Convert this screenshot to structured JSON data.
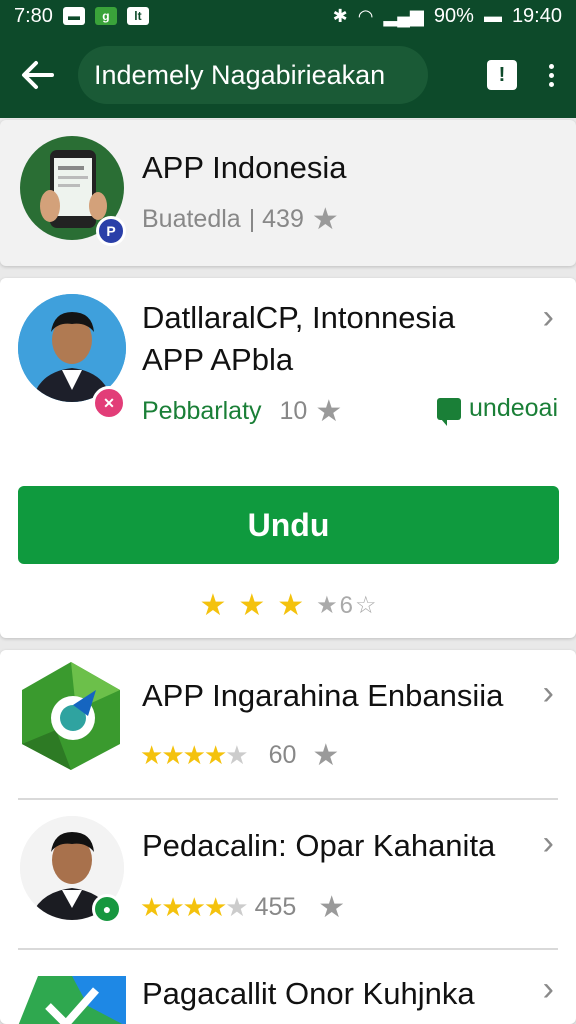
{
  "status_bar": {
    "time_left": "7:80",
    "battery": "90%",
    "time_right": "19:40"
  },
  "app_bar": {
    "search_text": "Indemely Nagabirieakan"
  },
  "featured_app": {
    "title": "APP Indonesia",
    "meta_label": "Buatedla",
    "meta_count": "| 439"
  },
  "detail_app": {
    "title_line1": "DatllaralCP, Intonnesia",
    "title_line2": "APP APbla",
    "publisher": "Pebbarlaty",
    "rating_count": "10",
    "updates_label": "undeoai",
    "install_label": "Undu",
    "rating_summary": {
      "stars_filled": 3,
      "count": "6"
    }
  },
  "list": [
    {
      "title": "APP Ingarahina Enbansiia",
      "rating": 4,
      "count": "60"
    },
    {
      "title": "Pedacalin: Opar Kahanita",
      "rating": 4,
      "count": "455"
    },
    {
      "title": "Pagacallit Onor Kuhjnka"
    }
  ],
  "colors": {
    "header": "#0d4a2a",
    "accent": "#0f9a3e",
    "star": "#f4c20d"
  }
}
